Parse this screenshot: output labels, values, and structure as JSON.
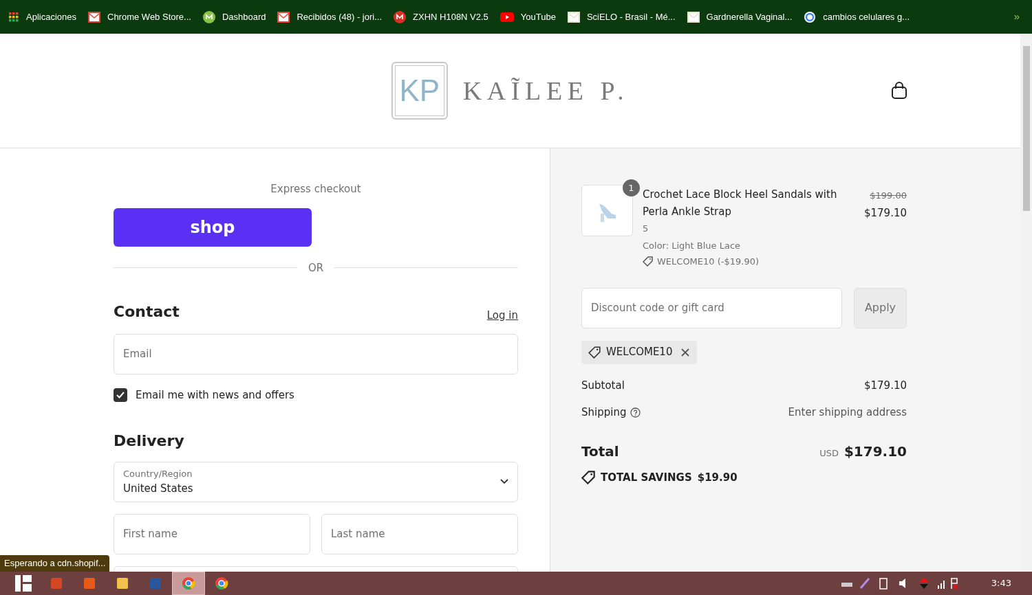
{
  "bookmarks": [
    {
      "label": "Aplicaciones",
      "kind": "apps"
    },
    {
      "label": "Chrome Web Store...",
      "kind": "store"
    },
    {
      "label": "Dashboard",
      "kind": "dash"
    },
    {
      "label": "Recibidos (48) - jori...",
      "kind": "mail"
    },
    {
      "label": "ZXHN H108N V2.5",
      "kind": "m"
    },
    {
      "label": "YouTube",
      "kind": "yt"
    },
    {
      "label": "SciELO - Brasil - Mé...",
      "kind": "doc"
    },
    {
      "label": "Gardnerella Vaginal...",
      "kind": "doc"
    },
    {
      "label": "cambios celulares g...",
      "kind": "g"
    }
  ],
  "bookmarks_more": "»",
  "logo": {
    "monogram": "KP",
    "name": "KAĨLEE P."
  },
  "express": {
    "title": "Express checkout",
    "shop_button": "shop",
    "divider": "OR"
  },
  "contact": {
    "heading": "Contact",
    "login": "Log in",
    "email_placeholder": "Email",
    "newsletter": {
      "label": "Email me with news and offers",
      "checked": true
    }
  },
  "delivery": {
    "heading": "Delivery",
    "country_label": "Country/Region",
    "country_value": "United States",
    "first_name_placeholder": "First name",
    "last_name_placeholder": "Last name"
  },
  "order": {
    "item": {
      "quantity": "1",
      "name": "Crochet Lace Block Heel Sandals with Perla Ankle Strap",
      "variant": "5",
      "color_text": "Color: Light Blue Lace",
      "discount": "WELCOME10 (-$19.90)",
      "original_price": "$199.00",
      "price": "$179.10"
    },
    "discount_placeholder": "Discount code or gift card",
    "apply": "Apply",
    "applied_code": "WELCOME10",
    "subtotal_label": "Subtotal",
    "subtotal": "$179.10",
    "shipping_label": "Shipping",
    "shipping": "Enter shipping address",
    "total_label": "Total",
    "currency": "USD",
    "total": "$179.10",
    "savings_label": "TOTAL SAVINGS",
    "savings": "$19.90"
  },
  "status_text": "Esperando a cdn.shopif...",
  "taskbar": {
    "apps": [
      {
        "kind": "tiles",
        "selected": false
      },
      {
        "kind": "ppt",
        "selected": false
      },
      {
        "kind": "fire",
        "selected": false
      },
      {
        "kind": "folder",
        "selected": false
      },
      {
        "kind": "word",
        "selected": false
      },
      {
        "kind": "chrome",
        "selected": true
      },
      {
        "kind": "chrome",
        "selected": false
      }
    ],
    "clock": "3:43"
  }
}
